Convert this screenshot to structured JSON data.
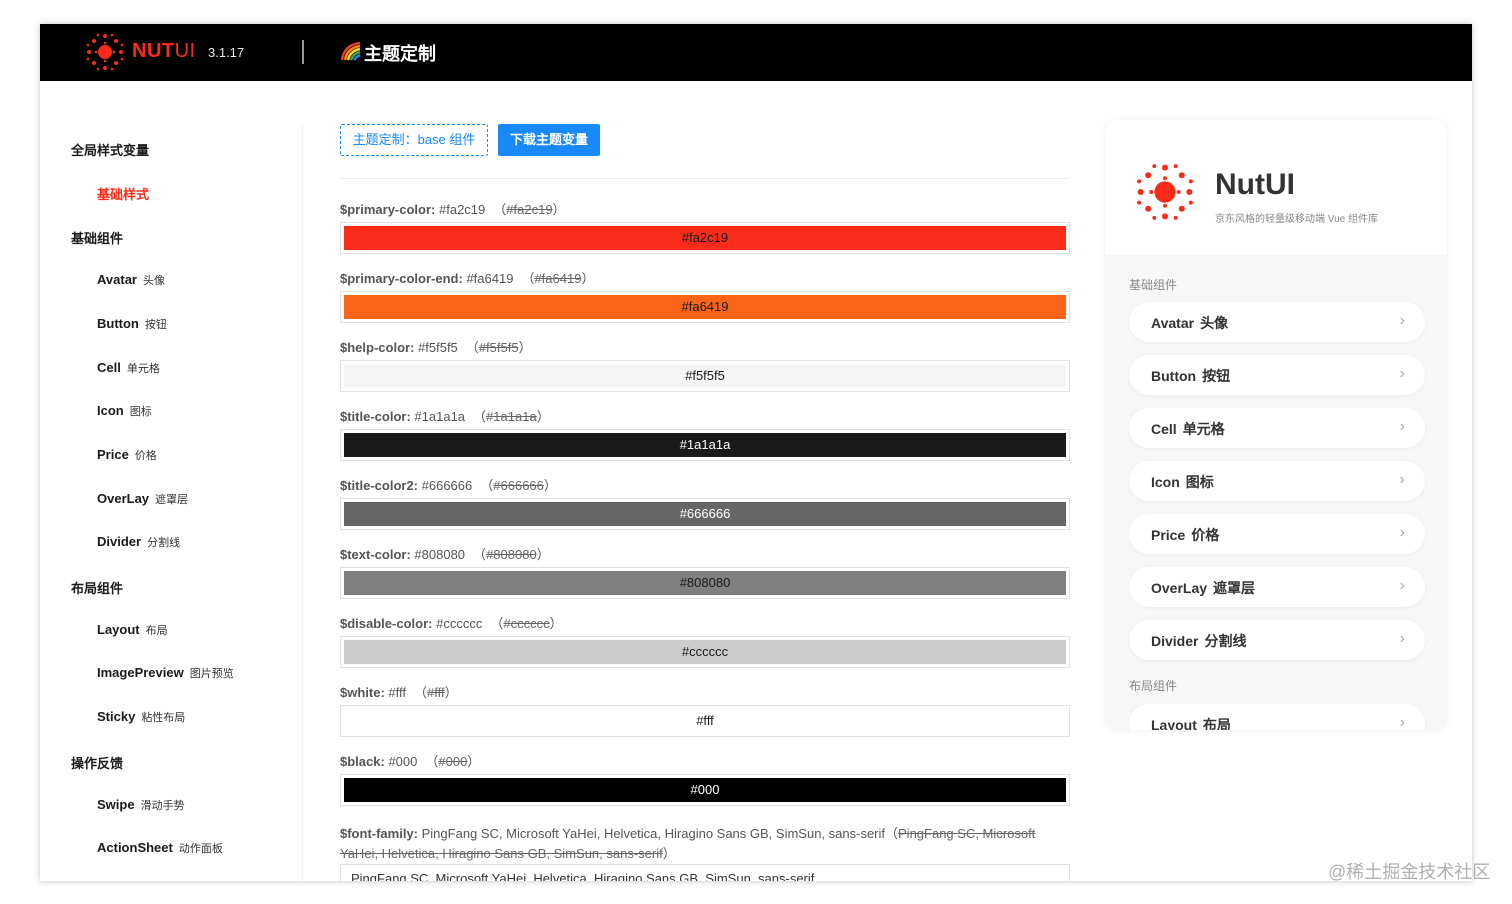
{
  "header": {
    "brand_bold": "NUT",
    "brand_thin": "UI",
    "version": "3.1.17",
    "title": "主题定制"
  },
  "sidebar": {
    "groups": [
      {
        "label": "全局样式变量",
        "items": [
          {
            "label": "基础样式",
            "cn": ""
          }
        ]
      },
      {
        "label": "基础组件",
        "items": [
          {
            "label": "Avatar",
            "cn": "头像"
          },
          {
            "label": "Button",
            "cn": "按钮"
          },
          {
            "label": "Cell",
            "cn": "单元格"
          },
          {
            "label": "Icon",
            "cn": "图标"
          },
          {
            "label": "Price",
            "cn": "价格"
          },
          {
            "label": "OverLay",
            "cn": "遮罩层"
          },
          {
            "label": "Divider",
            "cn": "分割线"
          }
        ]
      },
      {
        "label": "布局组件",
        "items": [
          {
            "label": "Layout",
            "cn": "布局"
          },
          {
            "label": "ImagePreview",
            "cn": "图片预览"
          },
          {
            "label": "Sticky",
            "cn": "粘性布局"
          }
        ]
      },
      {
        "label": "操作反馈",
        "items": [
          {
            "label": "Swipe",
            "cn": "滑动手势"
          },
          {
            "label": "ActionSheet",
            "cn": "动作面板"
          }
        ]
      }
    ]
  },
  "toolbar": {
    "theme_button": "主题定制：base 组件",
    "download_button": "下载主题变量"
  },
  "variables": [
    {
      "name": "$primary-color:",
      "value": "#fa2c19",
      "orig": "#fa2c19",
      "swatch_text": "#fa2c19",
      "bg": "#fa2c19",
      "fg": "#1a1a1a"
    },
    {
      "name": "$primary-color-end:",
      "value": "#fa6419",
      "orig": "#fa6419",
      "swatch_text": "#fa6419",
      "bg": "#fa6419",
      "fg": "#1a1a1a"
    },
    {
      "name": "$help-color:",
      "value": "#f5f5f5",
      "orig": "#f5f5f5",
      "swatch_text": "#f5f5f5",
      "bg": "#f5f5f5",
      "fg": "#1a1a1a"
    },
    {
      "name": "$title-color:",
      "value": "#1a1a1a",
      "orig": "#1a1a1a",
      "swatch_text": "#1a1a1a",
      "bg": "#1a1a1a",
      "fg": "#ffffff"
    },
    {
      "name": "$title-color2:",
      "value": "#666666",
      "orig": "#666666",
      "swatch_text": "#666666",
      "bg": "#666666",
      "fg": "#ffffff"
    },
    {
      "name": "$text-color:",
      "value": "#808080",
      "orig": "#808080",
      "swatch_text": "#808080",
      "bg": "#808080",
      "fg": "#1a1a1a"
    },
    {
      "name": "$disable-color:",
      "value": "#cccccc",
      "orig": "#cccccc",
      "swatch_text": "#cccccc",
      "bg": "#cccccc",
      "fg": "#1a1a1a"
    },
    {
      "name": "$white:",
      "value": "#fff",
      "orig": "#fff",
      "swatch_text": "#fff",
      "bg": "#ffffff",
      "fg": "#1a1a1a"
    },
    {
      "name": "$black:",
      "value": "#000",
      "orig": "#000",
      "swatch_text": "#000",
      "bg": "#000000",
      "fg": "#ffffff"
    }
  ],
  "font_family": {
    "name": "$font-family:",
    "value": "PingFang SC, Microsoft YaHei, Helvetica, Hiragino Sans GB, SimSun, sans-serif",
    "orig": "PingFang SC, Microsoft YaHei, Helvetica, Hiragino Sans GB, SimSun, sans-serif",
    "input_value": "PingFang SC, Microsoft YaHei, Helvetica, Hiragino Sans GB, SimSun, sans-serif"
  },
  "preview": {
    "title": "NutUI",
    "subtitle": "京东风格的轻量级移动端 Vue 组件库",
    "group1": "基础组件",
    "items": [
      {
        "label": "Avatar",
        "cn": "头像"
      },
      {
        "label": "Button",
        "cn": "按钮"
      },
      {
        "label": "Cell",
        "cn": "单元格"
      },
      {
        "label": "Icon",
        "cn": "图标"
      },
      {
        "label": "Price",
        "cn": "价格"
      },
      {
        "label": "OverLay",
        "cn": "遮罩层"
      },
      {
        "label": "Divider",
        "cn": "分割线"
      }
    ],
    "group2": "布局组件",
    "partial_item": {
      "label": "Layout",
      "cn": "布局"
    },
    "chevron": "›"
  },
  "watermark": "@稀土掘金技术社区",
  "colors": {
    "brand": "#fa2c19",
    "accent": "#1989fa"
  }
}
